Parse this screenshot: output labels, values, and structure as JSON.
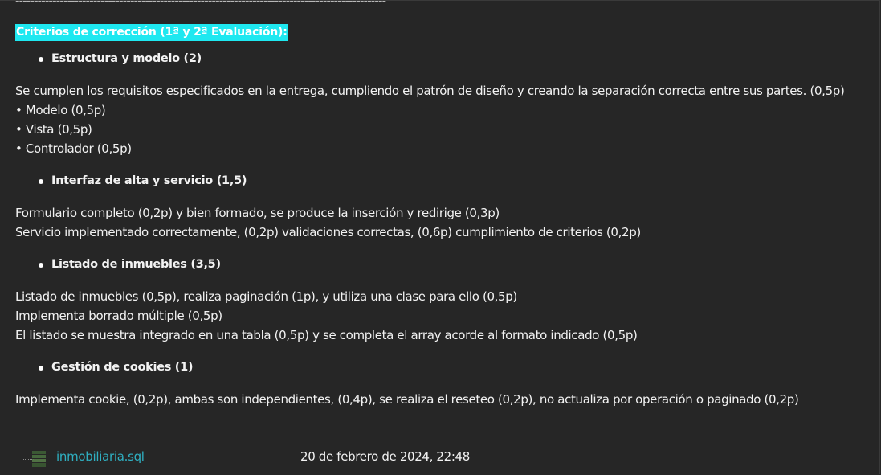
{
  "separator": "----------------------------------------------------------------------------------------------------",
  "heading": "Criterios de corrección (1ª y 2ª Evaluación):",
  "criteria": [
    {
      "title": "Estructura y modelo (2)",
      "lines": [
        "Se cumplen los requisitos especificados en la entrega, cumpliendo el patrón de diseño y creando la separación correcta entre sus partes. (0,5p)",
        "• Modelo (0,5p)",
        "• Vista (0,5p)",
        "• Controlador (0,5p)"
      ]
    },
    {
      "title": "Interfaz de alta y servicio (1,5)",
      "lines": [
        "Formulario completo (0,2p) y bien formado, se produce la inserción y redirige (0,3p)",
        "Servicio implementado correctamente, (0,2p) validaciones correctas, (0,6p) cumplimiento de criterios (0,2p)"
      ]
    },
    {
      "title": "Listado de inmuebles (3,5)",
      "lines": [
        "Listado de inmuebles (0,5p), realiza paginación (1p), y utiliza una clase para ello (0,5p)",
        "Implementa borrado múltiple (0,5p)",
        "El listado se muestra integrado en una tabla (0,5p) y se completa el array acorde al formato indicado (0,5p)"
      ]
    },
    {
      "title": "Gestión de cookies (1)",
      "lines": [
        "Implementa cookie, (0,2p), ambas son independientes, (0,4p), se realiza el reseteo (0,2p), no actualiza por operación o paginado (0,2p)"
      ]
    }
  ],
  "attachment": {
    "icon": "sql-file-icon",
    "filename": "inmobiliaria.sql",
    "date": "20 de febrero de 2024, 22:48"
  },
  "colors": {
    "background": "#262626",
    "highlight": "#1ee8f0",
    "link": "#2fb0c2"
  }
}
